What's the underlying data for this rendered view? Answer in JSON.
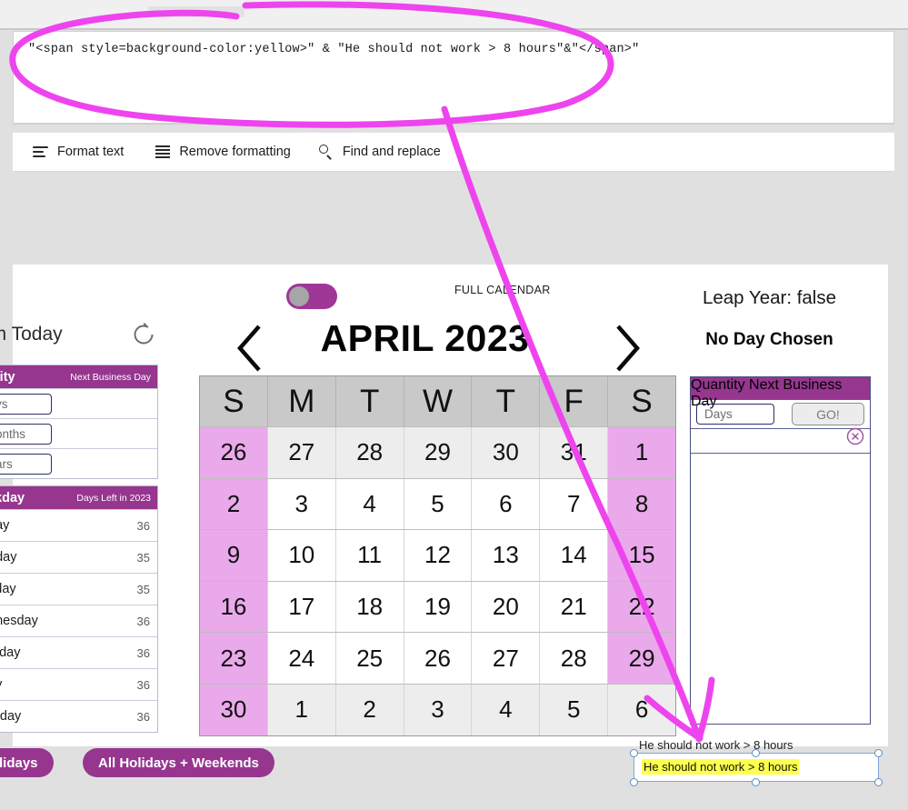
{
  "formula_bar": {
    "value": "\"<span style=background-color:yellow>\" & \"He should not work > 8 hours\"&\"</span>\""
  },
  "toolbar": {
    "items": [
      {
        "label": "Format text",
        "icon": "format-text-icon"
      },
      {
        "label": "Remove formatting",
        "icon": "remove-formatting-icon"
      },
      {
        "label": "Find and replace",
        "icon": "search-icon"
      }
    ]
  },
  "left_panel": {
    "title": "om Today",
    "refresh_icon": "refresh-icon",
    "quantity_table": {
      "header_left": "ntity",
      "header_right": "Next Business Day",
      "rows": [
        {
          "input_value": "ys",
          "result": ""
        },
        {
          "input_value": "onths",
          "result": ""
        },
        {
          "input_value": "ars",
          "result": ""
        }
      ]
    },
    "weekday_table": {
      "header_left": "ekday",
      "header_right": "Days Left in 2023",
      "rows": [
        {
          "day": "day",
          "count": "36"
        },
        {
          "day": "nday",
          "count": "35"
        },
        {
          "day": "sday",
          "count": "35"
        },
        {
          "day": "dnesday",
          "count": "36"
        },
        {
          "day": "rsday",
          "count": "36"
        },
        {
          "day": "ay",
          "count": "36"
        },
        {
          "day": "urday",
          "count": "36"
        }
      ]
    },
    "buttons": [
      {
        "label": "Holidays"
      },
      {
        "label": "All Holidays + Weekends"
      }
    ]
  },
  "calendar": {
    "toggle_state": "off",
    "full_calendar_label": "FULL CALENDAR",
    "prev_label": "previous-month",
    "next_label": "next-month",
    "month_title": "APRIL 2023",
    "weekday_headers": [
      "S",
      "M",
      "T",
      "W",
      "T",
      "F",
      "S"
    ],
    "weeks": [
      [
        {
          "d": "26",
          "out": true,
          "we": true
        },
        {
          "d": "27",
          "out": true,
          "we": false
        },
        {
          "d": "28",
          "out": true,
          "we": false
        },
        {
          "d": "29",
          "out": true,
          "we": false
        },
        {
          "d": "30",
          "out": true,
          "we": false
        },
        {
          "d": "31",
          "out": true,
          "we": false
        },
        {
          "d": "1",
          "out": false,
          "we": true
        }
      ],
      [
        {
          "d": "2",
          "out": false,
          "we": true
        },
        {
          "d": "3",
          "out": false,
          "we": false
        },
        {
          "d": "4",
          "out": false,
          "we": false
        },
        {
          "d": "5",
          "out": false,
          "we": false
        },
        {
          "d": "6",
          "out": false,
          "we": false
        },
        {
          "d": "7",
          "out": false,
          "we": false
        },
        {
          "d": "8",
          "out": false,
          "we": true
        }
      ],
      [
        {
          "d": "9",
          "out": false,
          "we": true
        },
        {
          "d": "10",
          "out": false,
          "we": false
        },
        {
          "d": "11",
          "out": false,
          "we": false
        },
        {
          "d": "12",
          "out": false,
          "we": false
        },
        {
          "d": "13",
          "out": false,
          "we": false
        },
        {
          "d": "14",
          "out": false,
          "we": false
        },
        {
          "d": "15",
          "out": false,
          "we": true
        }
      ],
      [
        {
          "d": "16",
          "out": false,
          "we": true
        },
        {
          "d": "17",
          "out": false,
          "we": false
        },
        {
          "d": "18",
          "out": false,
          "we": false
        },
        {
          "d": "19",
          "out": false,
          "we": false
        },
        {
          "d": "20",
          "out": false,
          "we": false
        },
        {
          "d": "21",
          "out": false,
          "we": false
        },
        {
          "d": "22",
          "out": false,
          "we": true
        }
      ],
      [
        {
          "d": "23",
          "out": false,
          "we": true
        },
        {
          "d": "24",
          "out": false,
          "we": false
        },
        {
          "d": "25",
          "out": false,
          "we": false
        },
        {
          "d": "26",
          "out": false,
          "we": false
        },
        {
          "d": "27",
          "out": false,
          "we": false
        },
        {
          "d": "28",
          "out": false,
          "we": false
        },
        {
          "d": "29",
          "out": false,
          "we": true
        }
      ],
      [
        {
          "d": "30",
          "out": false,
          "we": true
        },
        {
          "d": "1",
          "out": true,
          "we": false
        },
        {
          "d": "2",
          "out": true,
          "we": false
        },
        {
          "d": "3",
          "out": true,
          "we": false
        },
        {
          "d": "4",
          "out": true,
          "we": false
        },
        {
          "d": "5",
          "out": true,
          "we": false
        },
        {
          "d": "6",
          "out": true,
          "we": false
        }
      ]
    ]
  },
  "right_panel": {
    "leap_year": "Leap Year: false",
    "day_chosen": "No Day Chosen",
    "quantity_table": {
      "header_left": "Quantity",
      "header_right": "Next Business Day",
      "input_value": "Days",
      "go_label": "GO!",
      "clear_icon": "clear-circle-x-icon"
    }
  },
  "annotation": {
    "plain_text": "He should not work > 8 hours",
    "textbox_text": "He should not work > 8 hours",
    "highlight_color": "#ffff4d",
    "ink_color": "#ee44ee"
  },
  "colors": {
    "brand_purple": "#96368f",
    "weekend_pink": "#eaa9ea",
    "header_gray": "#c9c9c9",
    "outside_month": "#ededed"
  }
}
